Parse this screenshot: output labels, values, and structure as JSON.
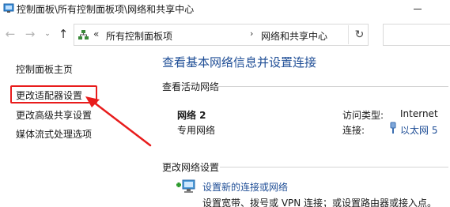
{
  "window": {
    "title": "控制面板\\所有控制面板项\\网络和共享中心"
  },
  "address_bar": {
    "chevron": "«",
    "crumbs": [
      "所有控制面板项",
      "网络和共享中心"
    ],
    "separator": "›"
  },
  "left_nav": {
    "items": [
      "控制面板主页",
      "更改适配器设置",
      "更改高级共享设置",
      "媒体流式处理选项"
    ]
  },
  "main": {
    "title": "查看基本网络信息并设置连接",
    "active_networks_label": "查看活动网络",
    "network": {
      "name": "网络 2",
      "type": "专用网络",
      "access_type_label": "访问类型:",
      "access_type_value": "Internet",
      "connections_label": "连接:",
      "connections_value": "以太网 5"
    },
    "change_settings_label": "更改网络设置",
    "setup": {
      "link": "设置新的连接或网络",
      "description": "设置宽带、拨号或 VPN 连接；或设置路由器或接入点。"
    }
  },
  "colors": {
    "link": "#1f4e96",
    "highlight": "#e81c1c"
  },
  "icons": [
    "control-panel-icon",
    "back-arrow-icon",
    "forward-arrow-icon",
    "up-arrow-icon",
    "network-center-icon",
    "refresh-icon",
    "ethernet-icon",
    "new-connection-icon"
  ]
}
